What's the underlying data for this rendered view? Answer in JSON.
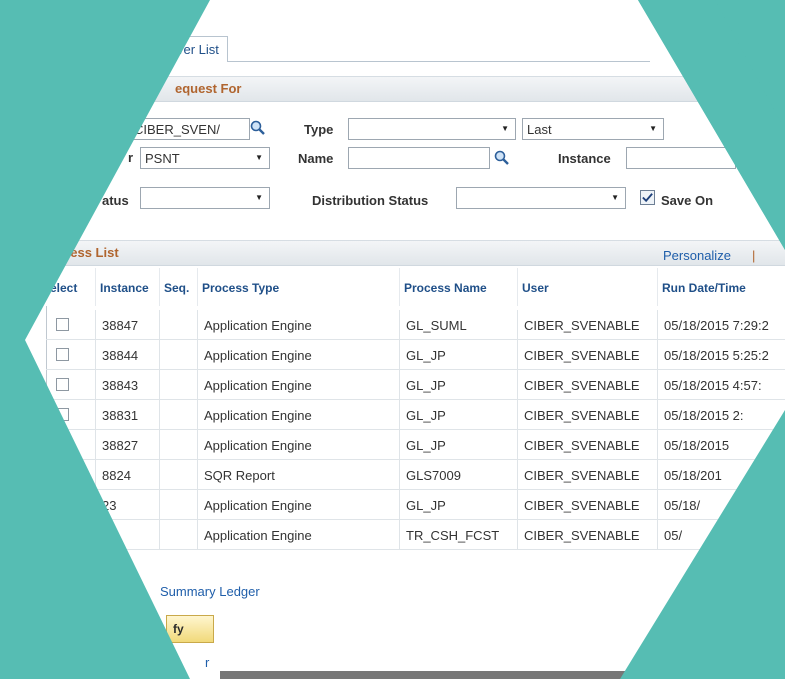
{
  "tab": {
    "label": "ver List"
  },
  "request_section": {
    "title": "equest For"
  },
  "filters": {
    "user_value": "CIBER_SVEN/",
    "server_label": "r",
    "server_value": "PSNT",
    "status_label": "atus",
    "status_value": "",
    "type_label": "Type",
    "type_value": "",
    "range_value": "Last",
    "name_label": "Name",
    "name_value": "",
    "instance_label": "Instance",
    "instance_value": "",
    "distribution_label": "Distribution Status",
    "distribution_value": "",
    "save_on_label": "Save On"
  },
  "process_list": {
    "title": "cess List",
    "personalize": "Personalize",
    "personalize_sep": "|",
    "columns": [
      "elect",
      "Instance",
      "Seq.",
      "Process Type",
      "Process Name",
      "User",
      "Run Date/Time"
    ],
    "rows": [
      {
        "instance": "38847",
        "seq": "",
        "type": "Application Engine",
        "name": "GL_SUML",
        "user": "CIBER_SVENABLE",
        "run": "05/18/2015  7:29:2"
      },
      {
        "instance": "38844",
        "seq": "",
        "type": "Application Engine",
        "name": "GL_JP",
        "user": "CIBER_SVENABLE",
        "run": "05/18/2015  5:25:2"
      },
      {
        "instance": "38843",
        "seq": "",
        "type": "Application Engine",
        "name": "GL_JP",
        "user": "CIBER_SVENABLE",
        "run": "05/18/2015  4:57:"
      },
      {
        "instance": "38831",
        "seq": "",
        "type": "Application Engine",
        "name": "GL_JP",
        "user": "CIBER_SVENABLE",
        "run": "05/18/2015  2:"
      },
      {
        "instance": "38827",
        "seq": "",
        "type": "Application Engine",
        "name": "GL_JP",
        "user": "CIBER_SVENABLE",
        "run": "05/18/2015"
      },
      {
        "instance": "8824",
        "seq": "",
        "type": "SQR Report",
        "name": "GLS7009",
        "user": "CIBER_SVENABLE",
        "run": "05/18/201"
      },
      {
        "instance": "23",
        "seq": "",
        "type": "Application Engine",
        "name": "GL_JP",
        "user": "CIBER_SVENABLE",
        "run": "05/18/"
      },
      {
        "instance": "",
        "seq": "",
        "type": "Application Engine",
        "name": "TR_CSH_FCST",
        "user": "CIBER_SVENABLE",
        "run": "05/"
      }
    ]
  },
  "footer": {
    "link": "Summary Ledger",
    "button": "fy",
    "bottom_link": "r"
  },
  "colors": {
    "teal": "#56bdb3",
    "link": "#1f5eaa",
    "header_orange": "#b0652f"
  }
}
